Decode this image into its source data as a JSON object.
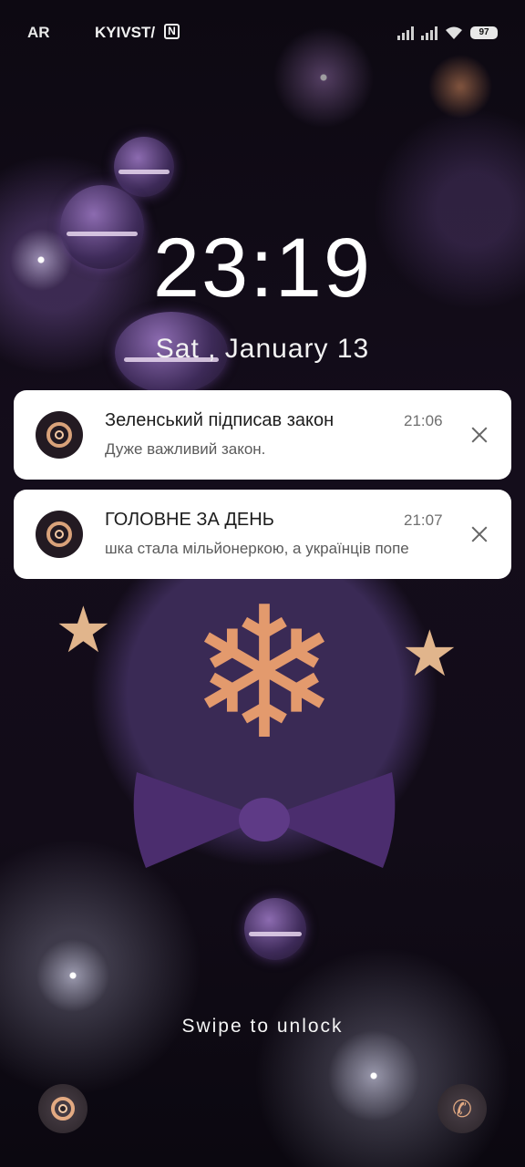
{
  "status_bar": {
    "carrier_1": "AR",
    "carrier_2": "KYIVST/",
    "nfc_icon": "N",
    "battery": "97",
    "icons": [
      "nfc-icon",
      "signal-icon",
      "wifi-icon",
      "battery-icon"
    ]
  },
  "lock_screen": {
    "time": "23:19",
    "date": "Sat , January 13"
  },
  "notifications": [
    {
      "app_icon": "chrome-style-app-icon",
      "title": "Зеленський підписав закон",
      "time": "21:06",
      "body": "Дуже важливий закон."
    },
    {
      "app_icon": "chrome-style-app-icon",
      "title": "ГОЛОВНЕ ЗА ДЕНЬ",
      "time": "21:07",
      "body": "шка стала мільйонеркою, а українців попе"
    }
  ],
  "swipe_hint": "Swipe to unlock",
  "shortcuts": {
    "left": "camera-icon",
    "right": "phone-icon"
  },
  "colors": {
    "accent_gold": "#e39a6d",
    "notification_bg": "#ffffff",
    "wallpaper_purple": "#3a2a55"
  }
}
